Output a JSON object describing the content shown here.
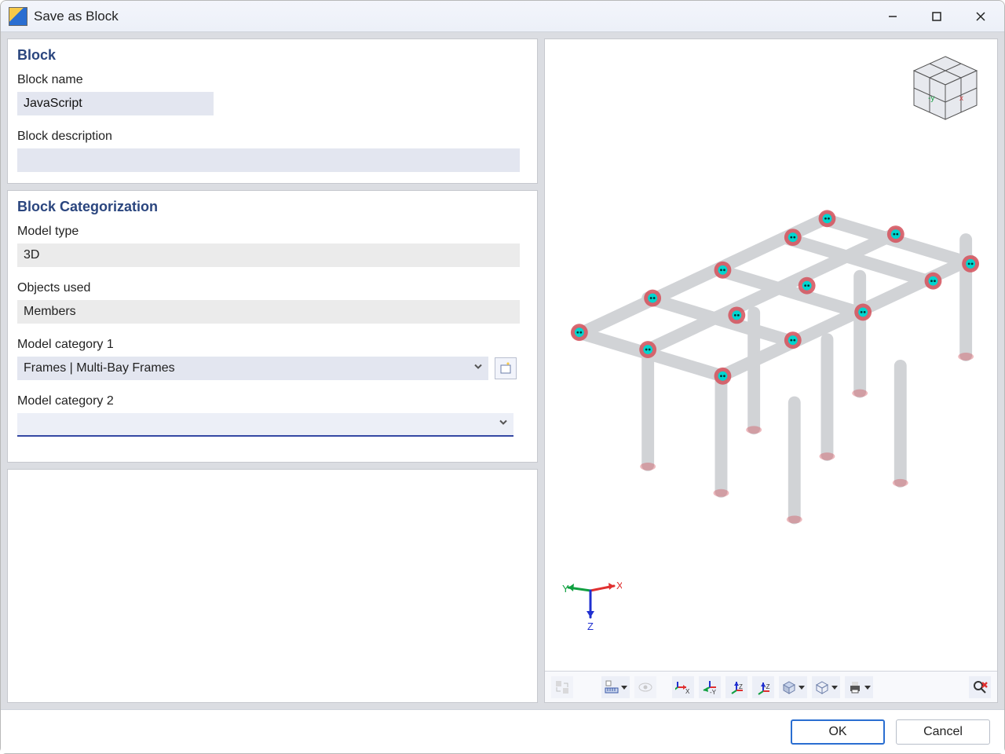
{
  "window": {
    "title": "Save as Block"
  },
  "sections": {
    "block": {
      "heading": "Block",
      "name_label": "Block name",
      "name_value": "JavaScript",
      "desc_label": "Block description",
      "desc_value": ""
    },
    "cat": {
      "heading": "Block Categorization",
      "model_type_label": "Model type",
      "model_type_value": "3D",
      "objects_label": "Objects used",
      "objects_value": "Members",
      "cat1_label": "Model category 1",
      "cat1_value": "Frames | Multi-Bay Frames",
      "cat2_label": "Model category 2",
      "cat2_value": ""
    }
  },
  "axes": {
    "x": "X",
    "y": "Y",
    "z": "Z"
  },
  "footer": {
    "ok": "OK",
    "cancel": "Cancel"
  },
  "toolbar_icons": {
    "swap": "swap-view-icon",
    "ruler": "ruler-dropdown-icon",
    "eye": "visibility-icon",
    "view_x": "view-x-icon",
    "view_y": "view-y-icon",
    "view_z": "view-z-icon",
    "view_negz": "view-neg-z-icon",
    "iso": "isometric-icon",
    "box": "bounding-box-icon",
    "print": "print-icon",
    "reset": "reset-zoom-icon"
  }
}
